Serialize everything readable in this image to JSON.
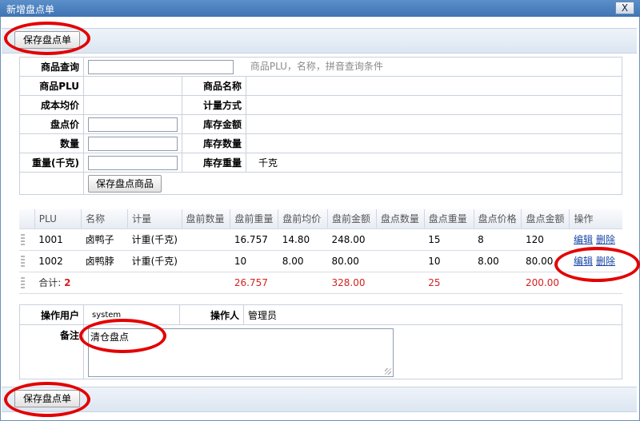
{
  "window": {
    "title": "新增盘点单",
    "close_label": "X"
  },
  "toolbar": {
    "save_label": "保存盘点单"
  },
  "form": {
    "query_label": "商品查询",
    "query_value": "",
    "query_hint": "商品PLU，名称，拼音查询条件",
    "plu_label": "商品PLU",
    "plu_value": "",
    "name_label": "商品名称",
    "name_value": "",
    "cost_label": "成本均价",
    "cost_value": "",
    "unit_label": "计量方式",
    "unit_value": "",
    "price_label": "盘点价",
    "stock_amount_label": "库存金额",
    "qty_label": "数量",
    "stock_qty_label": "库存数量",
    "weight_label": "重量(千克)",
    "stock_weight_label": "库存重量",
    "stock_weight_unit": "千克",
    "save_item_label": "保存盘点商品"
  },
  "grid": {
    "columns": [
      "PLU",
      "名称",
      "计量",
      "盘前数量",
      "盘前重量",
      "盘前均价",
      "盘前金额",
      "盘点数量",
      "盘点重量",
      "盘点价格",
      "盘点金额",
      "操作"
    ],
    "rows": [
      {
        "plu": "1001",
        "name": "卤鸭子",
        "unit": "计重(千克)",
        "pre_qty": "",
        "pre_weight": "16.757",
        "pre_avg": "14.80",
        "pre_amount": "248.00",
        "cnt_qty": "",
        "cnt_weight": "15",
        "cnt_price": "8",
        "cnt_amount": "120",
        "edit": "编辑",
        "delete": "删除"
      },
      {
        "plu": "1002",
        "name": "卤鸭脖",
        "unit": "计重(千克)",
        "pre_qty": "",
        "pre_weight": "10",
        "pre_avg": "8.00",
        "pre_amount": "80.00",
        "cnt_qty": "",
        "cnt_weight": "10",
        "cnt_price": "8.00",
        "cnt_amount": "80.00",
        "edit": "编辑",
        "delete": "删除"
      }
    ],
    "total": {
      "label": "合计:",
      "count": "2",
      "pre_weight": "26.757",
      "pre_amount": "328.00",
      "cnt_weight": "25",
      "cnt_amount": "200.00"
    }
  },
  "footer": {
    "user_label": "操作用户",
    "user_value": "system",
    "operator_label": "操作人",
    "operator_value": "管理员",
    "remark_label": "备注",
    "remark_value": "清仓盘点"
  },
  "colors": {
    "titlebar": "#4a80c0",
    "total_red": "#d61f1f",
    "link": "#1b47a8",
    "annotation_ring": "#e30000"
  }
}
